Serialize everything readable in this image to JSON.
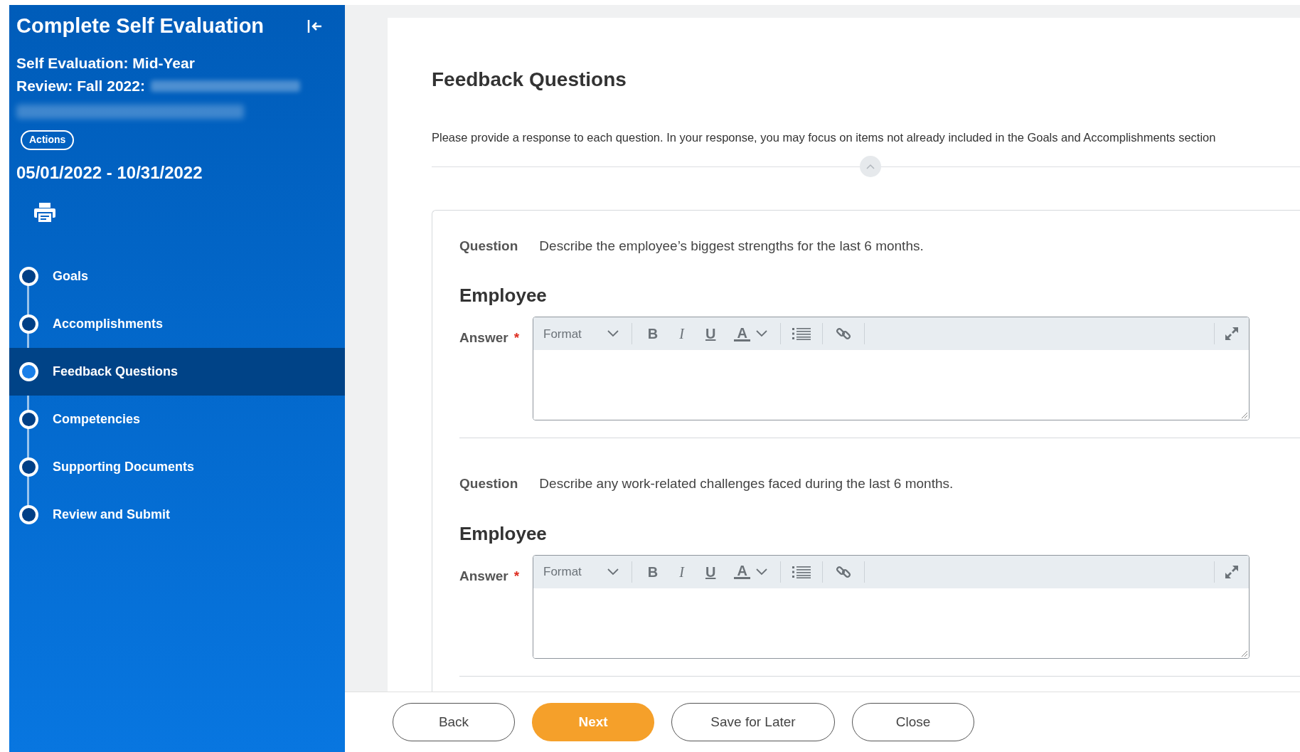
{
  "sidebar": {
    "title": "Complete Self Evaluation",
    "subtitle_lines": [
      "Self Evaluation: Mid-Year",
      "Review: Fall 2022:"
    ],
    "actions_button": "Actions",
    "date_range": "05/01/2022 - 10/31/2022",
    "steps": [
      {
        "label": "Goals",
        "selected": false
      },
      {
        "label": "Accomplishments",
        "selected": false
      },
      {
        "label": "Feedback Questions",
        "selected": true
      },
      {
        "label": "Competencies",
        "selected": false
      },
      {
        "label": "Supporting Documents",
        "selected": false
      },
      {
        "label": "Review and Submit",
        "selected": false
      }
    ]
  },
  "page": {
    "heading": "Feedback Questions",
    "instructions": "Please provide a response to each question. In your response, you may focus on items not already included in the Goals and Accomplishments section",
    "questions": [
      {
        "label": "Question",
        "text": "Describe the employee’s biggest strengths for the last 6 months.",
        "section": "Employee",
        "answer_label": "Answer",
        "required_mark": "*",
        "format_placeholder": "Format",
        "tools": [
          {
            "kind": "bold",
            "label": "B"
          },
          {
            "kind": "italic",
            "label": "I"
          },
          {
            "kind": "underline",
            "label": "U"
          },
          {
            "kind": "color",
            "label": "A"
          }
        ]
      },
      {
        "label": "Question",
        "text": "Describe any work-related challenges faced during the last 6 months.",
        "section": "Employee",
        "answer_label": "Answer",
        "required_mark": "*",
        "format_placeholder": "Format",
        "tools": [
          {
            "kind": "bold",
            "label": "B"
          },
          {
            "kind": "italic",
            "label": "I"
          },
          {
            "kind": "underline",
            "label": "U"
          },
          {
            "kind": "color",
            "label": "A"
          }
        ]
      }
    ]
  },
  "footer": {
    "buttons": [
      {
        "label": "Back",
        "primary": false
      },
      {
        "label": "Next",
        "primary": true
      },
      {
        "label": "Save for Later",
        "primary": false
      },
      {
        "label": "Close",
        "primary": false
      }
    ]
  }
}
